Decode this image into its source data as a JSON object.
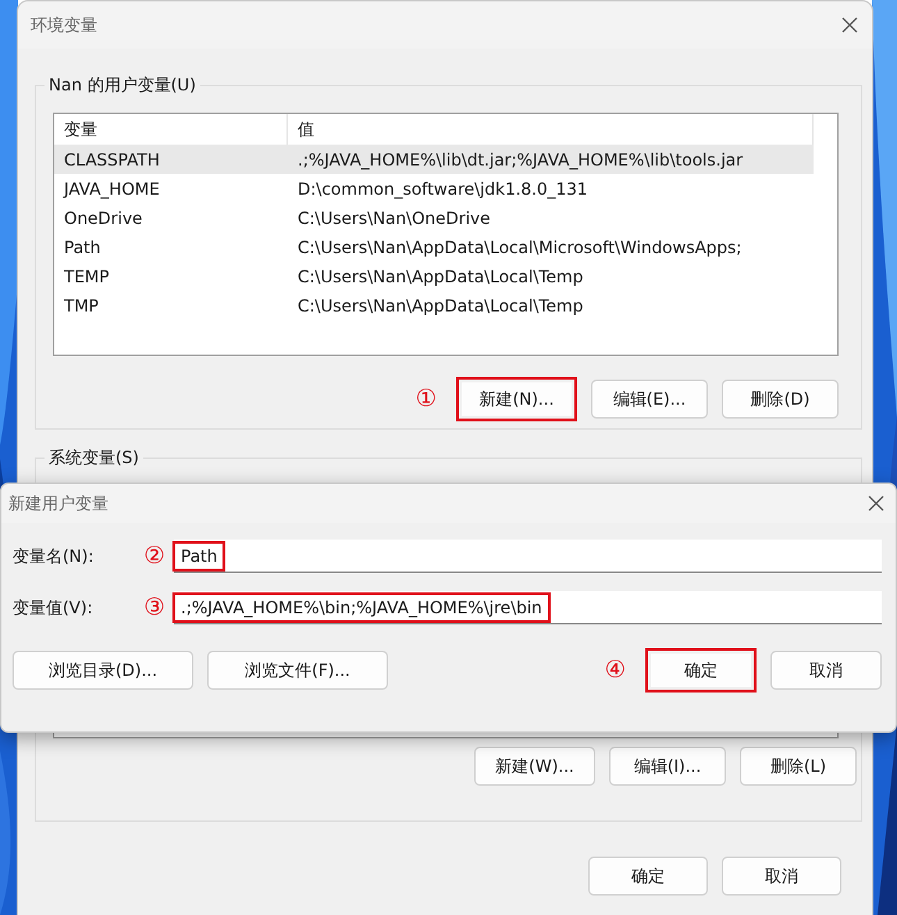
{
  "main_window": {
    "title": "环境变量",
    "user_group": {
      "title": "Nan 的用户变量(U)",
      "columns": [
        "变量",
        "值"
      ],
      "rows": [
        {
          "name": "CLASSPATH",
          "value": ".;%JAVA_HOME%\\lib\\dt.jar;%JAVA_HOME%\\lib\\tools.jar",
          "selected": true
        },
        {
          "name": "JAVA_HOME",
          "value": "D:\\common_software\\jdk1.8.0_131",
          "selected": false
        },
        {
          "name": "OneDrive",
          "value": "C:\\Users\\Nan\\OneDrive",
          "selected": false
        },
        {
          "name": "Path",
          "value": "C:\\Users\\Nan\\AppData\\Local\\Microsoft\\WindowsApps;",
          "selected": false
        },
        {
          "name": "TEMP",
          "value": "C:\\Users\\Nan\\AppData\\Local\\Temp",
          "selected": false
        },
        {
          "name": "TMP",
          "value": "C:\\Users\\Nan\\AppData\\Local\\Temp",
          "selected": false
        }
      ],
      "buttons": [
        {
          "label": "新建(N)...",
          "highlighted": true,
          "marker": "①"
        },
        {
          "label": "编辑(E)...",
          "highlighted": false
        },
        {
          "label": "删除(D)",
          "highlighted": false
        }
      ]
    },
    "system_group": {
      "title": "系统变量(S)",
      "buttons": [
        {
          "label": "新建(W)..."
        },
        {
          "label": "编辑(I)..."
        },
        {
          "label": "删除(L)"
        }
      ]
    },
    "buttons": [
      {
        "label": "确定"
      },
      {
        "label": "取消"
      }
    ]
  },
  "dialog": {
    "title": "新建用户变量",
    "fields": [
      {
        "label": "变量名(N):",
        "value": "Path",
        "marker": "②"
      },
      {
        "label": "变量值(V):",
        "value": ".;%JAVA_HOME%\\bin;%JAVA_HOME%\\jre\\bin",
        "marker": "③"
      }
    ],
    "left_buttons": [
      {
        "label": "浏览目录(D)..."
      },
      {
        "label": "浏览文件(F)..."
      }
    ],
    "right_buttons": [
      {
        "label": "确定",
        "highlighted": true,
        "marker": "④"
      },
      {
        "label": "取消",
        "highlighted": false
      }
    ]
  }
}
